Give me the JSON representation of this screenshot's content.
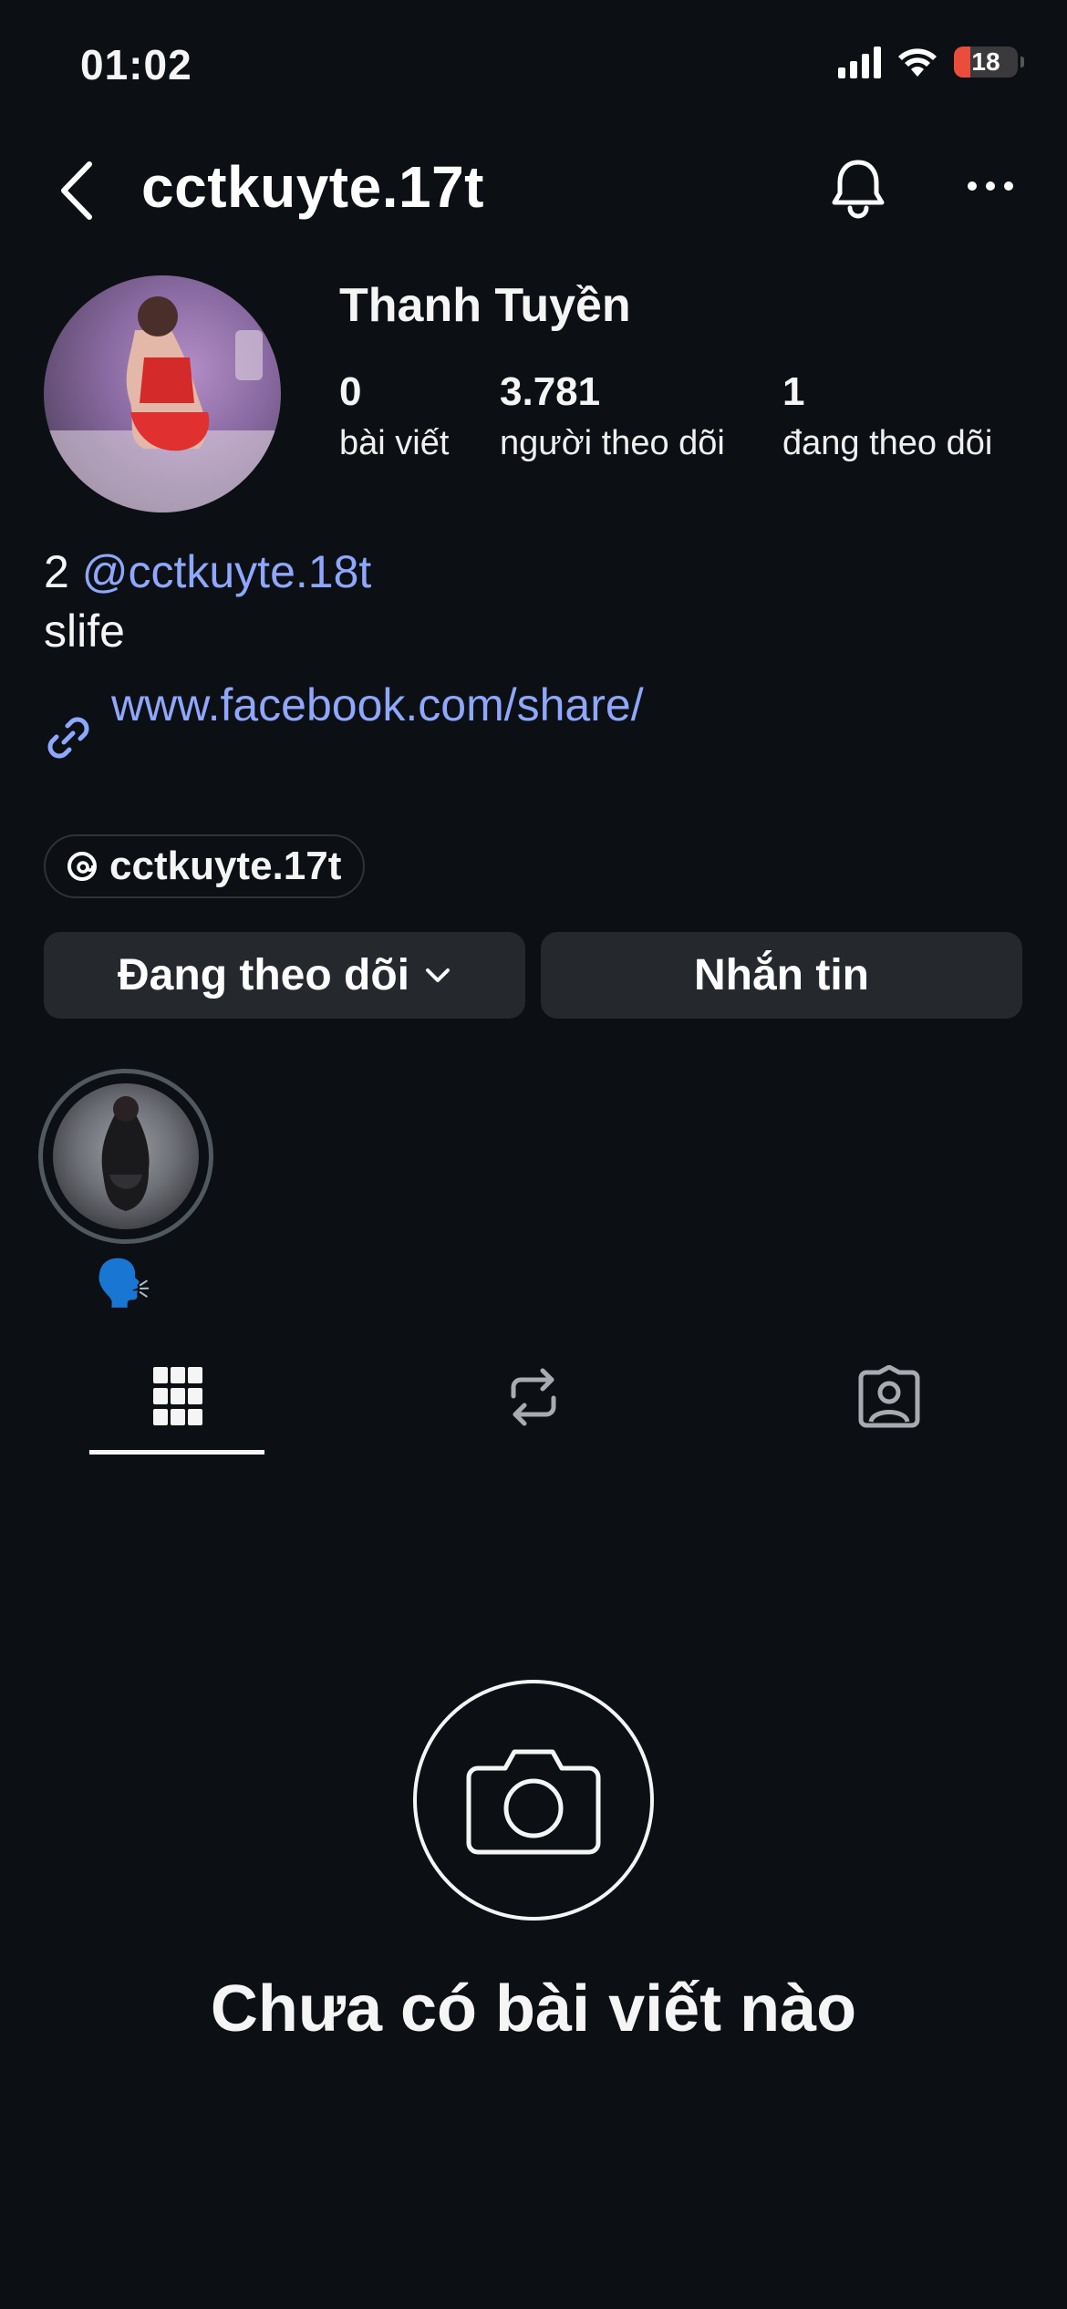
{
  "status_bar": {
    "time": "01:02",
    "battery": "18",
    "icons": [
      "signal-icon",
      "wifi-icon",
      "battery-icon"
    ]
  },
  "header": {
    "username": "cctkuyte.17t",
    "icons": [
      "back-icon",
      "bell-icon",
      "more-icon"
    ]
  },
  "profile": {
    "display_name": "Thanh Tuyền",
    "stats": [
      {
        "value": "0",
        "label": "bài viết"
      },
      {
        "value": "3.781",
        "label": "người theo dõi"
      },
      {
        "value": "1",
        "label": "đang theo dõi"
      }
    ],
    "bio": {
      "line1_prefix": "2",
      "line1_mention": "@cctkuyte.18t",
      "line2": "slife"
    },
    "link": "www.facebook.com/share/",
    "threads_handle": "cctkuyte.17t"
  },
  "actions": {
    "following_label": "Đang theo dõi",
    "message_label": "Nhắn tin"
  },
  "highlights": [
    {
      "label": "🗣️"
    }
  ],
  "tabs": [
    "grid-icon",
    "reposts-icon",
    "tagged-icon"
  ],
  "empty_state": {
    "title": "Chưa có bài viết nào"
  },
  "colors": {
    "background": "#0c1014",
    "link": "#8fa7ff",
    "button": "#25292e",
    "battery_low": "#eb4d3d"
  }
}
